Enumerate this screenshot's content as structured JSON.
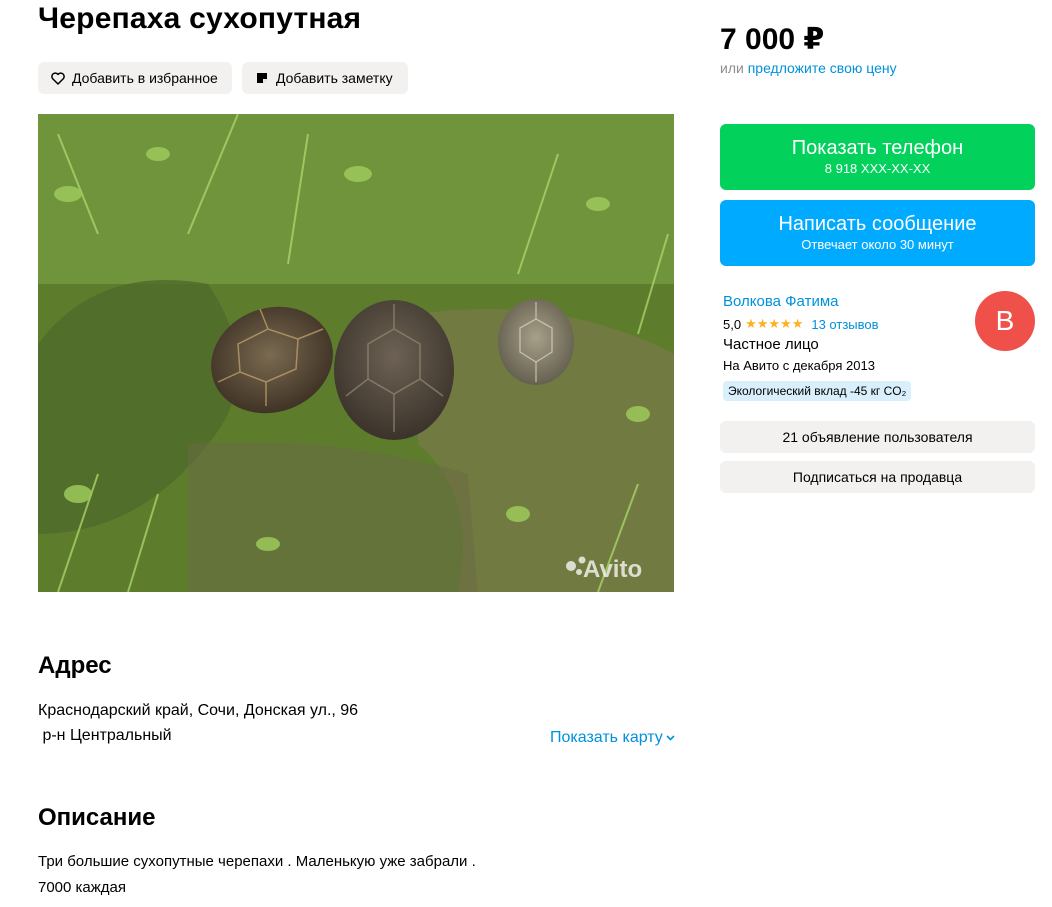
{
  "listing": {
    "title": "Черепаха сухопутная",
    "favorite_label": "Добавить в избранное",
    "note_label": "Добавить заметку",
    "photo_watermark": "Avito"
  },
  "address": {
    "heading": "Адрес",
    "line1": "Краснодарский край, Сочи, Донская ул., 96",
    "line2": " р-н Центральный",
    "map_link": "Показать карту"
  },
  "description": {
    "heading": "Описание",
    "line1": "Три большие сухопутные черепахи . Маленькую уже забрали .",
    "line2": "7000 каждая"
  },
  "price": {
    "value": "7 000 ₽",
    "or_text": "или",
    "offer_link": "предложите свою цену"
  },
  "actions": {
    "phone_main": "Показать телефон",
    "phone_sub": "8 918 XXX-XX-XX",
    "message_main": "Написать сообщение",
    "message_sub": "Отвечает около 30 минут"
  },
  "seller": {
    "name": "Волкова Фатима",
    "rating": "5,0",
    "stars": "★★★★★",
    "reviews": "13 отзывов",
    "type": "Частное лицо",
    "since": "На Авито с декабря 2013",
    "eco": "Экологический вклад -45 кг CO₂",
    "avatar_letter": "В",
    "ads_button": "21 объявление пользователя",
    "subscribe_button": "Подписаться на продавца"
  },
  "colors": {
    "phone_button": "#02d15c",
    "message_button": "#00aaff",
    "link": "#0091dc",
    "avatar": "#f0504a",
    "stars": "#ffb021"
  }
}
